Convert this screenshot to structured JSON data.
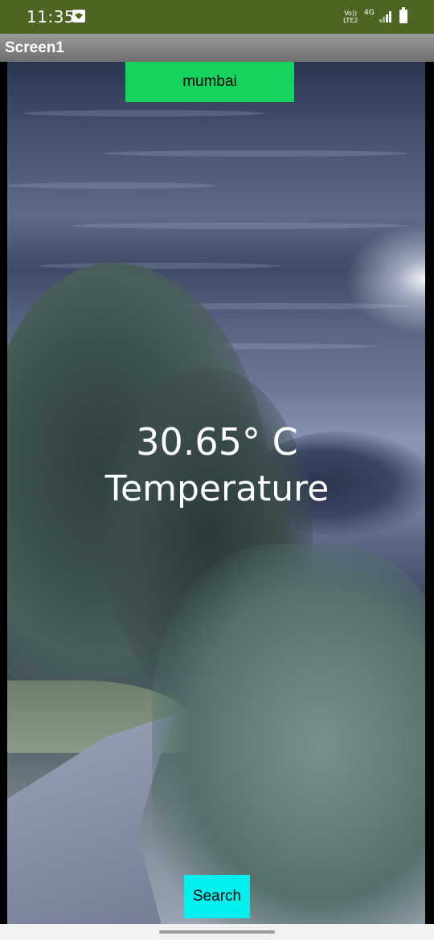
{
  "status_bar": {
    "time": "11:35",
    "network_volte": "Vo)) LTE2",
    "network_type": "4G",
    "icons": [
      "wifi-hotspot-icon",
      "signal-icon",
      "battery-icon"
    ]
  },
  "title_bar": {
    "title": "Screen1"
  },
  "main": {
    "city_input_value": "mumbai",
    "temperature_value": "30.65° C",
    "temperature_label": "Temperature",
    "search_label": "Search"
  },
  "colors": {
    "status_bar": "#4d6422",
    "input_background": "#14d45d",
    "button_background": "#00f0f0"
  }
}
